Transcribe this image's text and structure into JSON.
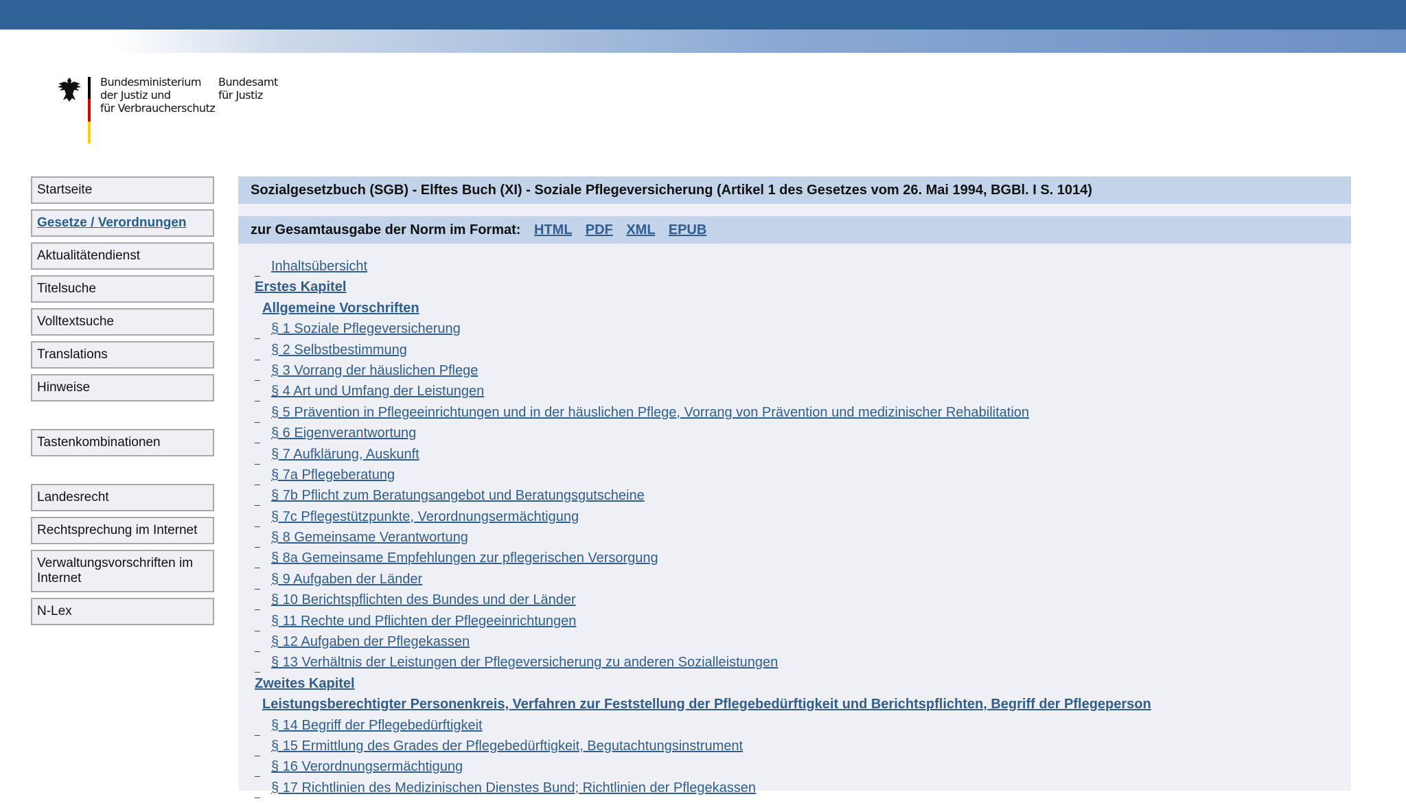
{
  "header": {
    "ministry_line1": "Bundesministerium",
    "ministry_line2": "der Justiz und",
    "ministry_line3": "für Verbraucherschutz",
    "office_line1": "Bundesamt",
    "office_line2": "für Justiz"
  },
  "nav": {
    "items": [
      {
        "label": "Startseite"
      },
      {
        "label": "Gesetze / Verordnungen"
      },
      {
        "label": "Aktualitätendienst"
      },
      {
        "label": "Titelsuche"
      },
      {
        "label": "Volltextsuche"
      },
      {
        "label": "Translations"
      },
      {
        "label": "Hinweise"
      },
      {
        "label": "Tastenkombinationen"
      },
      {
        "label": "Landesrecht"
      },
      {
        "label": "Rechtsprechung im Internet"
      },
      {
        "label": "Verwaltungsvorschriften im Internet"
      },
      {
        "label": "N-Lex"
      }
    ]
  },
  "main": {
    "title": "Sozialgesetzbuch (SGB) - Elftes Buch (XI) - Soziale Pflegeversicherung (Artikel 1 des Gesetzes vom 26. Mai 1994, BGBl. I S. 1014)",
    "format_label": "zur Gesamtausgabe der Norm im Format:",
    "formats": [
      "HTML",
      "PDF",
      "XML",
      "EPUB"
    ],
    "toc": [
      {
        "type": "item",
        "label": "Inhaltsübersicht"
      },
      {
        "type": "chapter",
        "label": "Erstes Kapitel"
      },
      {
        "type": "section",
        "label": "Allgemeine Vorschriften"
      },
      {
        "type": "item",
        "label": "§ 1 Soziale Pflegeversicherung"
      },
      {
        "type": "item",
        "label": "§ 2 Selbstbestimmung"
      },
      {
        "type": "item",
        "label": "§ 3 Vorrang der häuslichen Pflege"
      },
      {
        "type": "item",
        "label": "§ 4 Art und Umfang der Leistungen"
      },
      {
        "type": "item",
        "label": "§ 5 Prävention in Pflegeeinrichtungen und in der häuslichen Pflege, Vorrang von Prävention und medizinischer Rehabilitation"
      },
      {
        "type": "item",
        "label": "§ 6 Eigenverantwortung"
      },
      {
        "type": "item",
        "label": "§ 7 Aufklärung, Auskunft"
      },
      {
        "type": "item",
        "label": "§ 7a Pflegeberatung"
      },
      {
        "type": "item",
        "label": "§ 7b Pflicht zum Beratungsangebot und Beratungsgutscheine"
      },
      {
        "type": "item",
        "label": "§ 7c Pflegestützpunkte, Verordnungsermächtigung"
      },
      {
        "type": "item",
        "label": "§ 8 Gemeinsame Verantwortung"
      },
      {
        "type": "item",
        "label": "§ 8a Gemeinsame Empfehlungen zur pflegerischen Versorgung"
      },
      {
        "type": "item",
        "label": "§ 9 Aufgaben der Länder"
      },
      {
        "type": "item",
        "label": "§ 10 Berichtspflichten des Bundes und der Länder"
      },
      {
        "type": "item",
        "label": "§ 11 Rechte und Pflichten der Pflegeeinrichtungen"
      },
      {
        "type": "item",
        "label": "§ 12 Aufgaben der Pflegekassen"
      },
      {
        "type": "item",
        "label": "§ 13 Verhältnis der Leistungen der Pflegeversicherung zu anderen Sozialleistungen"
      },
      {
        "type": "chapter",
        "label": "Zweites Kapitel"
      },
      {
        "type": "section",
        "label": "Leistungsberechtigter Personenkreis, Verfahren zur Feststellung der Pflegebedürftigkeit und Berichtspflichten, Begriff der Pflegeperson"
      },
      {
        "type": "item",
        "label": "§ 14 Begriff der Pflegebedürftigkeit"
      },
      {
        "type": "item",
        "label": "§ 15 Ermittlung des Grades der Pflegebedürftigkeit, Begutachtungsinstrument"
      },
      {
        "type": "item",
        "label": "§ 16 Verordnungsermächtigung"
      },
      {
        "type": "item",
        "label": "§ 17 Richtlinien des Medizinischen Dienstes Bund; Richtlinien der Pflegekassen"
      }
    ]
  },
  "colors": {
    "top_bar": "#2f6398",
    "link": "#2f5d8e",
    "header_band": "#c3d4ea",
    "content_bg": "#eef0f5"
  }
}
